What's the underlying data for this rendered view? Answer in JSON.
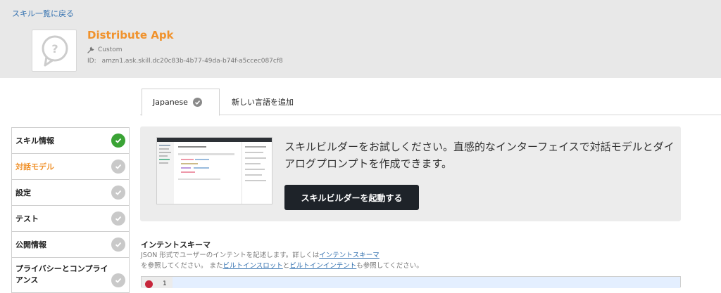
{
  "header": {
    "back_link": "スキル一覧に戻る",
    "skill_name": "Distribute Apk",
    "skill_type": "Custom",
    "id_label": "ID:",
    "id_value": "amzn1.ask.skill.dc20c83b-4b77-49da-b74f-a5ccec087cf8"
  },
  "tabs": {
    "active": "Japanese",
    "add_language": "新しい言語を追加"
  },
  "sidebar": {
    "items": [
      {
        "label": "スキル情報",
        "status": "complete"
      },
      {
        "label": "対話モデル",
        "status": "incomplete",
        "active": true
      },
      {
        "label": "設定",
        "status": "incomplete"
      },
      {
        "label": "テスト",
        "status": "incomplete"
      },
      {
        "label": "公開情報",
        "status": "incomplete"
      },
      {
        "label": "プライバシーとコンプライアンス",
        "status": "incomplete"
      }
    ]
  },
  "promo": {
    "text": "スキルビルダーをお試しください。直感的なインターフェイスで対話モデルとダイアログプロンプトを作成できます。",
    "button": "スキルビルダーを起動する"
  },
  "schema": {
    "title": "インテントスキーマ",
    "desc_part1": "JSON 形式でユーザーのインテントを記述します。詳しくは",
    "link1": "インテントスキーマ",
    "desc_part2": "を参照してください。 また",
    "link2": "ビルトインスロット",
    "desc_part3": "と",
    "link3": "ビルトインインテント",
    "desc_part4": "も参照してください。"
  },
  "editor": {
    "line_number": "1"
  },
  "colors": {
    "accent_orange": "#f0922c",
    "link_blue": "#3572b0",
    "check_green": "#3aa335",
    "check_gray": "#c9c9c9",
    "dark_button": "#1e2329",
    "error_red": "#c7263b"
  }
}
